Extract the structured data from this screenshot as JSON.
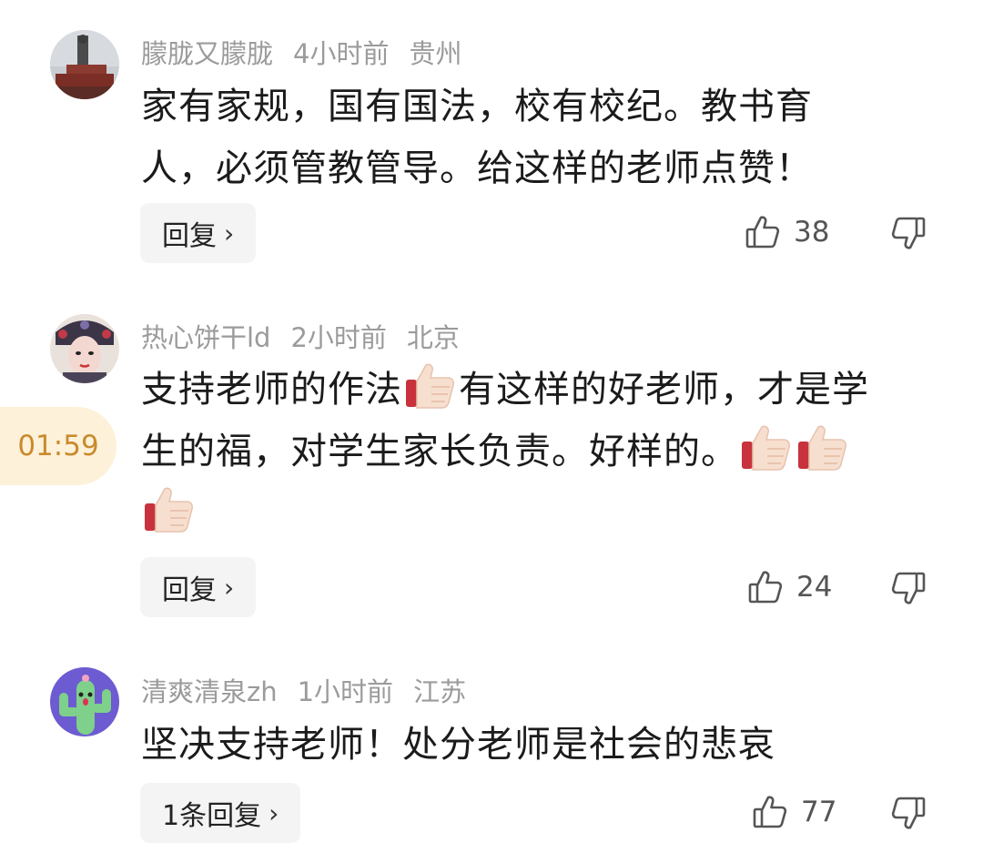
{
  "timer": "01:59",
  "comments": [
    {
      "username": "朦胧又朦胧",
      "time": "4小时前",
      "location": "贵州",
      "text_line1": "家有家规，国有国法，校有校纪。教书育",
      "text_line2": "人，必须管教管导。给这样的老师点赞！",
      "reply_label": "回复",
      "likes": "38"
    },
    {
      "username": "热心饼干ld",
      "time": "2小时前",
      "location": "北京",
      "text_a": "支持老师的作法",
      "text_b": "有这样的好老师，才是学",
      "text_c": "生的福，对学生家长负责。好样的。",
      "reply_label": "回复",
      "likes": "24"
    },
    {
      "username": "清爽清泉zh",
      "time": "1小时前",
      "location": "江苏",
      "text_line1": "坚决支持老师！处分老师是社会的悲哀",
      "reply_label": "1条回复",
      "likes": "77"
    }
  ]
}
